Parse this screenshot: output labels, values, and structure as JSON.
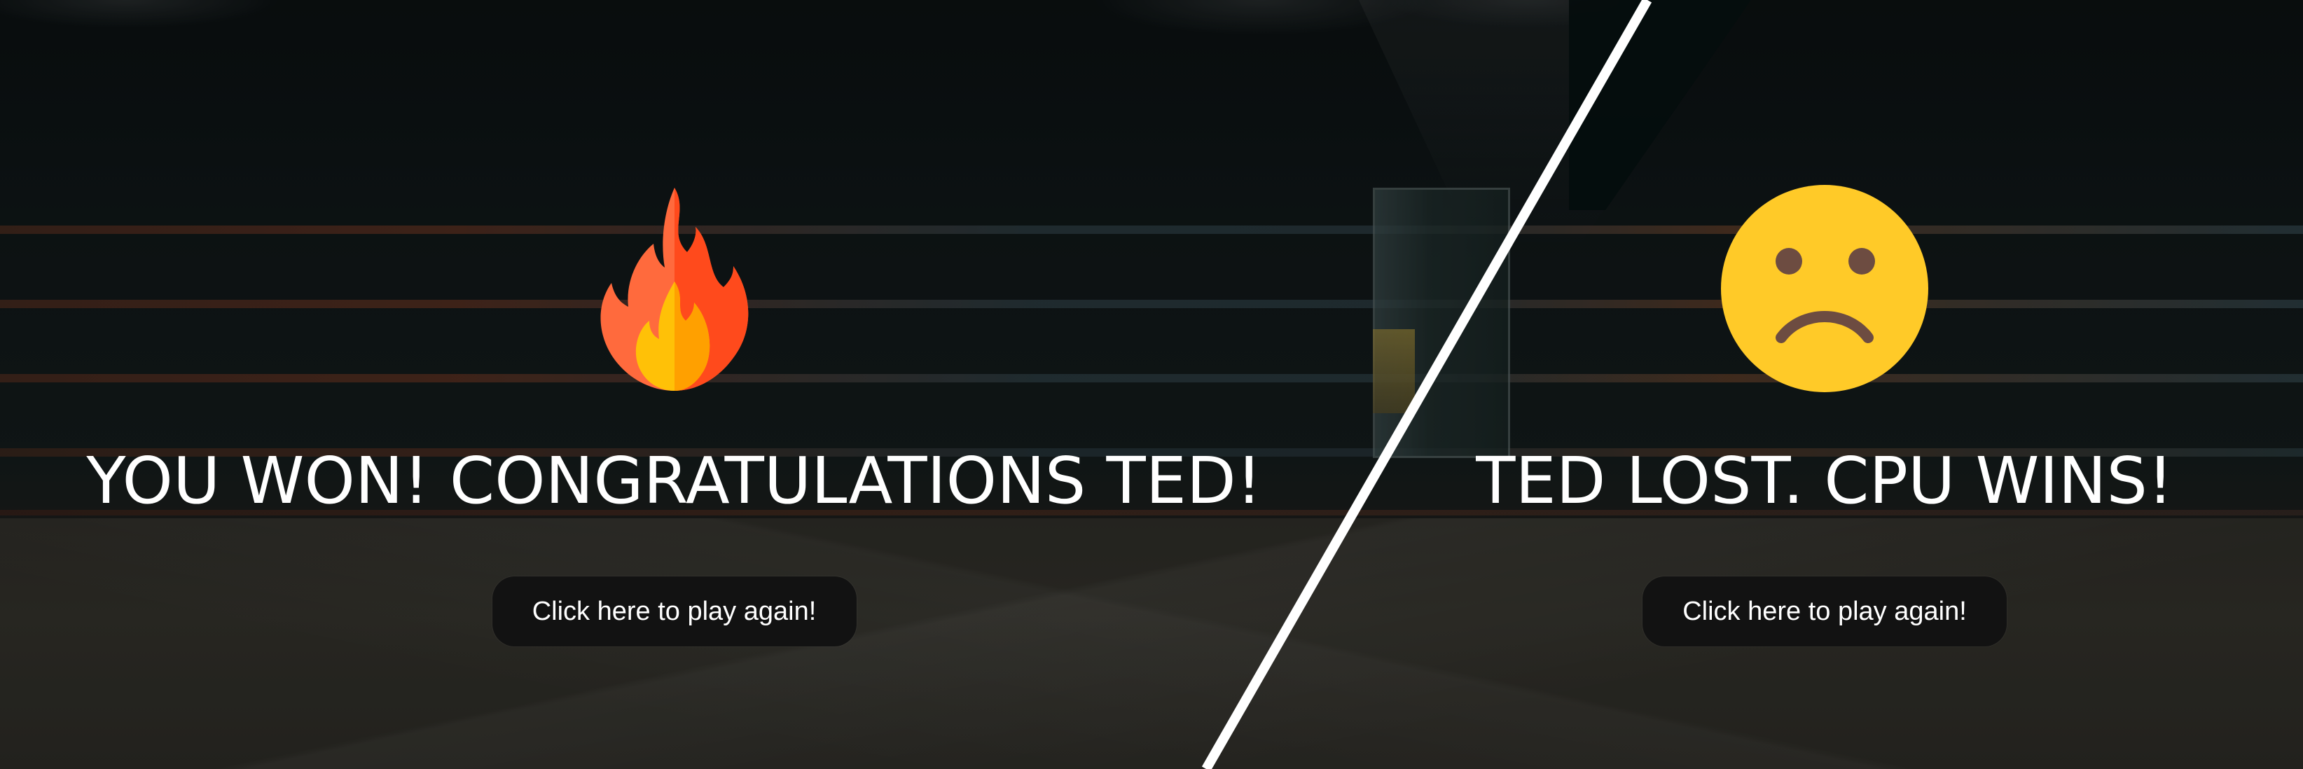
{
  "win_panel": {
    "icon": "fire-icon",
    "title": "YOU WON! CONGRATULATIONS TED!",
    "button_label": "Click here to play again!"
  },
  "lose_panel": {
    "icon": "sad-face-icon",
    "title": "TED LOST. CPU WINS!",
    "button_label": "Click here to play again!"
  },
  "colors": {
    "title_text": "#ffffff",
    "button_bg": "#121212",
    "button_text": "#ffffff",
    "divider": "#ffffff",
    "fire_outer": "#ff5a2c",
    "fire_inner": "#ffb300",
    "sad_face": "#ffca28",
    "sad_face_features": "#6d4c41"
  }
}
